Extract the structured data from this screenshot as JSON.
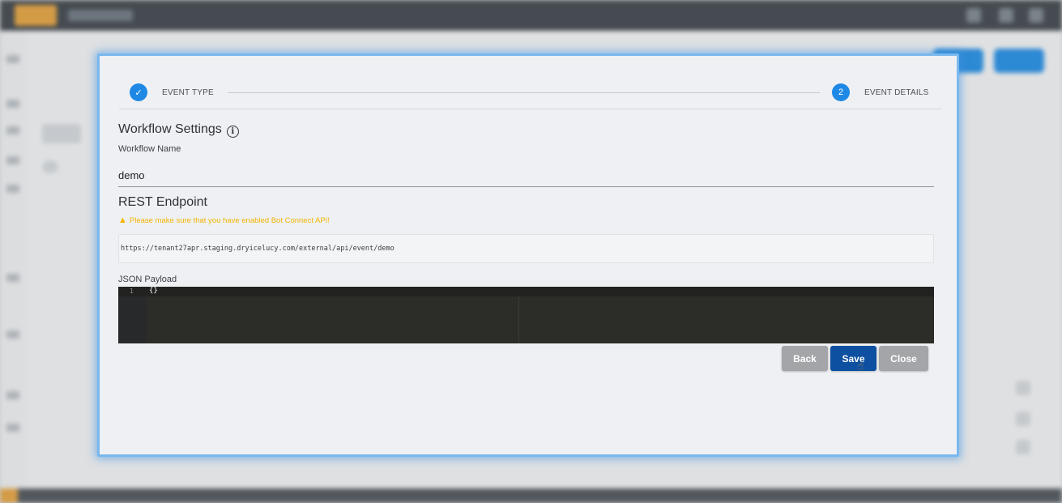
{
  "stepper": {
    "step1": {
      "label": "EVENT TYPE",
      "icon": "check-icon",
      "symbol": "✓"
    },
    "step2": {
      "label": "EVENT DETAILS",
      "number": "2"
    }
  },
  "workflow_settings": {
    "title": "Workflow Settings",
    "info_symbol": "i",
    "name_label": "Workflow Name",
    "name_value": "demo"
  },
  "rest_endpoint": {
    "title": "REST Endpoint",
    "warning_symbol": "▲",
    "warning": "Please make sure that you have enabled Bot Connect API!",
    "url": "https://tenant27apr.staging.dryicelucy.com/external/api/event/demo"
  },
  "json_payload": {
    "label": "JSON Payload",
    "line_number": "1",
    "code": "{}"
  },
  "buttons": {
    "back": "Back",
    "save": "Save",
    "close": "Close"
  },
  "cursor_symbol": "☝",
  "colors": {
    "accent": "#1e88e5",
    "save_button": "#0d4fa0",
    "warning": "#f4b400",
    "editor_bg": "#2c2d28"
  }
}
